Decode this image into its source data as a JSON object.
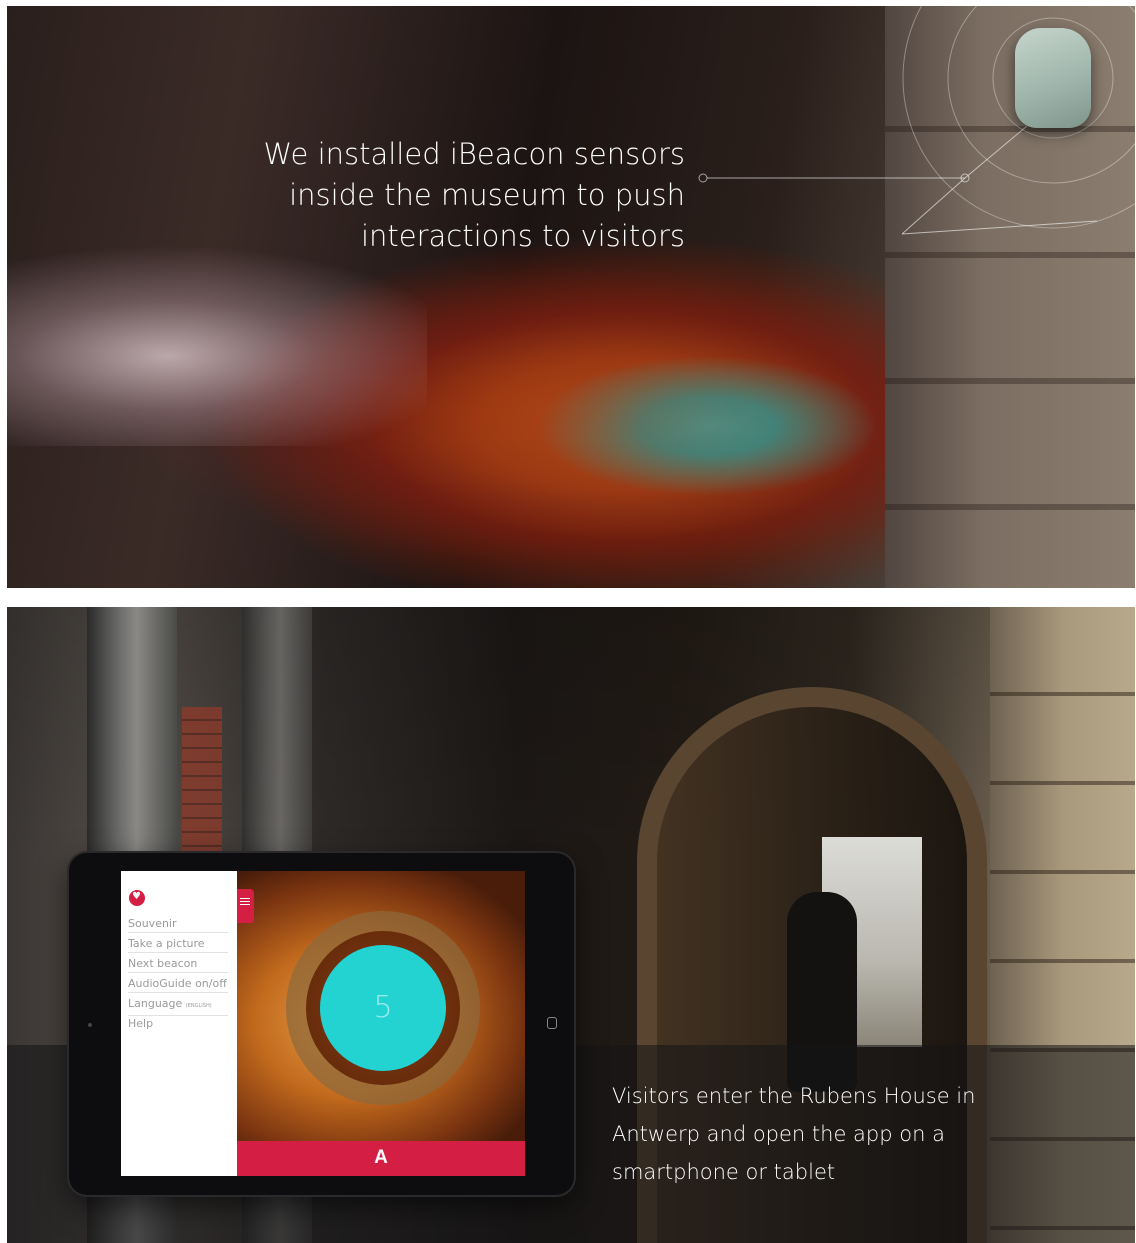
{
  "top_panel": {
    "caption_lines": [
      "We installed iBeacon sensors",
      "inside the museum to push",
      "interactions to visitors"
    ]
  },
  "bottom_panel": {
    "caption_lines": [
      "Visitors enter the Rubens House in",
      "Antwerp and open the app on a",
      "smartphone or tablet"
    ],
    "tablet": {
      "menu_items": [
        "Souvenir",
        "Take a picture",
        "Next beacon",
        "AudioGuide on/off",
        "Language",
        "Help"
      ],
      "language_tag": "(ENGLISH)",
      "countdown": "5",
      "brand_logo": "A",
      "accent_color": "#d41e44",
      "beacon_color": "#22d3d1"
    }
  }
}
